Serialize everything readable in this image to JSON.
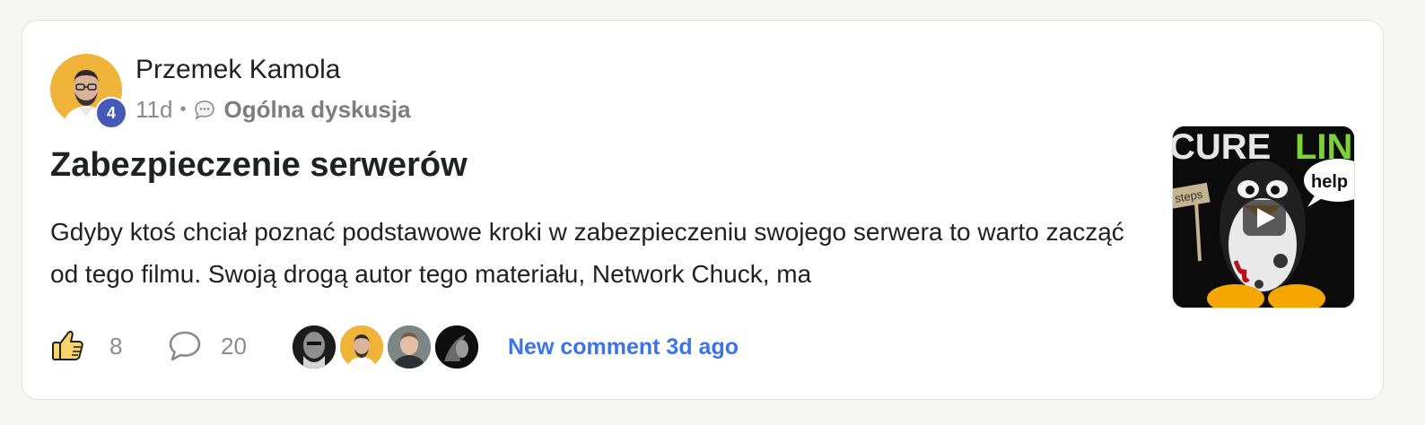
{
  "post": {
    "author": "Przemek Kamola",
    "level": "4",
    "age": "11d",
    "separator": "•",
    "category": "Ogólna dyskusja",
    "title": "Zabezpieczenie serwerów",
    "body": "Gdyby ktoś chciał poznać podstawowe kroki w zabezpieczeniu swojego serwera to warto zacząć od tego filmu. Swoją drogą autor tego materiału, Network Chuck, ma",
    "thumbnail_text": {
      "top_left": "CURE",
      "top_right": "LIN",
      "bubble": "help",
      "sign": "steps"
    },
    "likes": "8",
    "comments": "20",
    "last_activity": "New comment 3d ago"
  },
  "icons": {
    "like": "thumbs-up-icon",
    "comment": "comment-bubble-icon",
    "category": "chat-bubble-icon",
    "play": "play-icon"
  },
  "colors": {
    "accent_blue": "#3b74e8",
    "level_badge": "#4559b8",
    "avatar_bg": "#f0b43a",
    "muted_text": "#8b8b8b"
  }
}
